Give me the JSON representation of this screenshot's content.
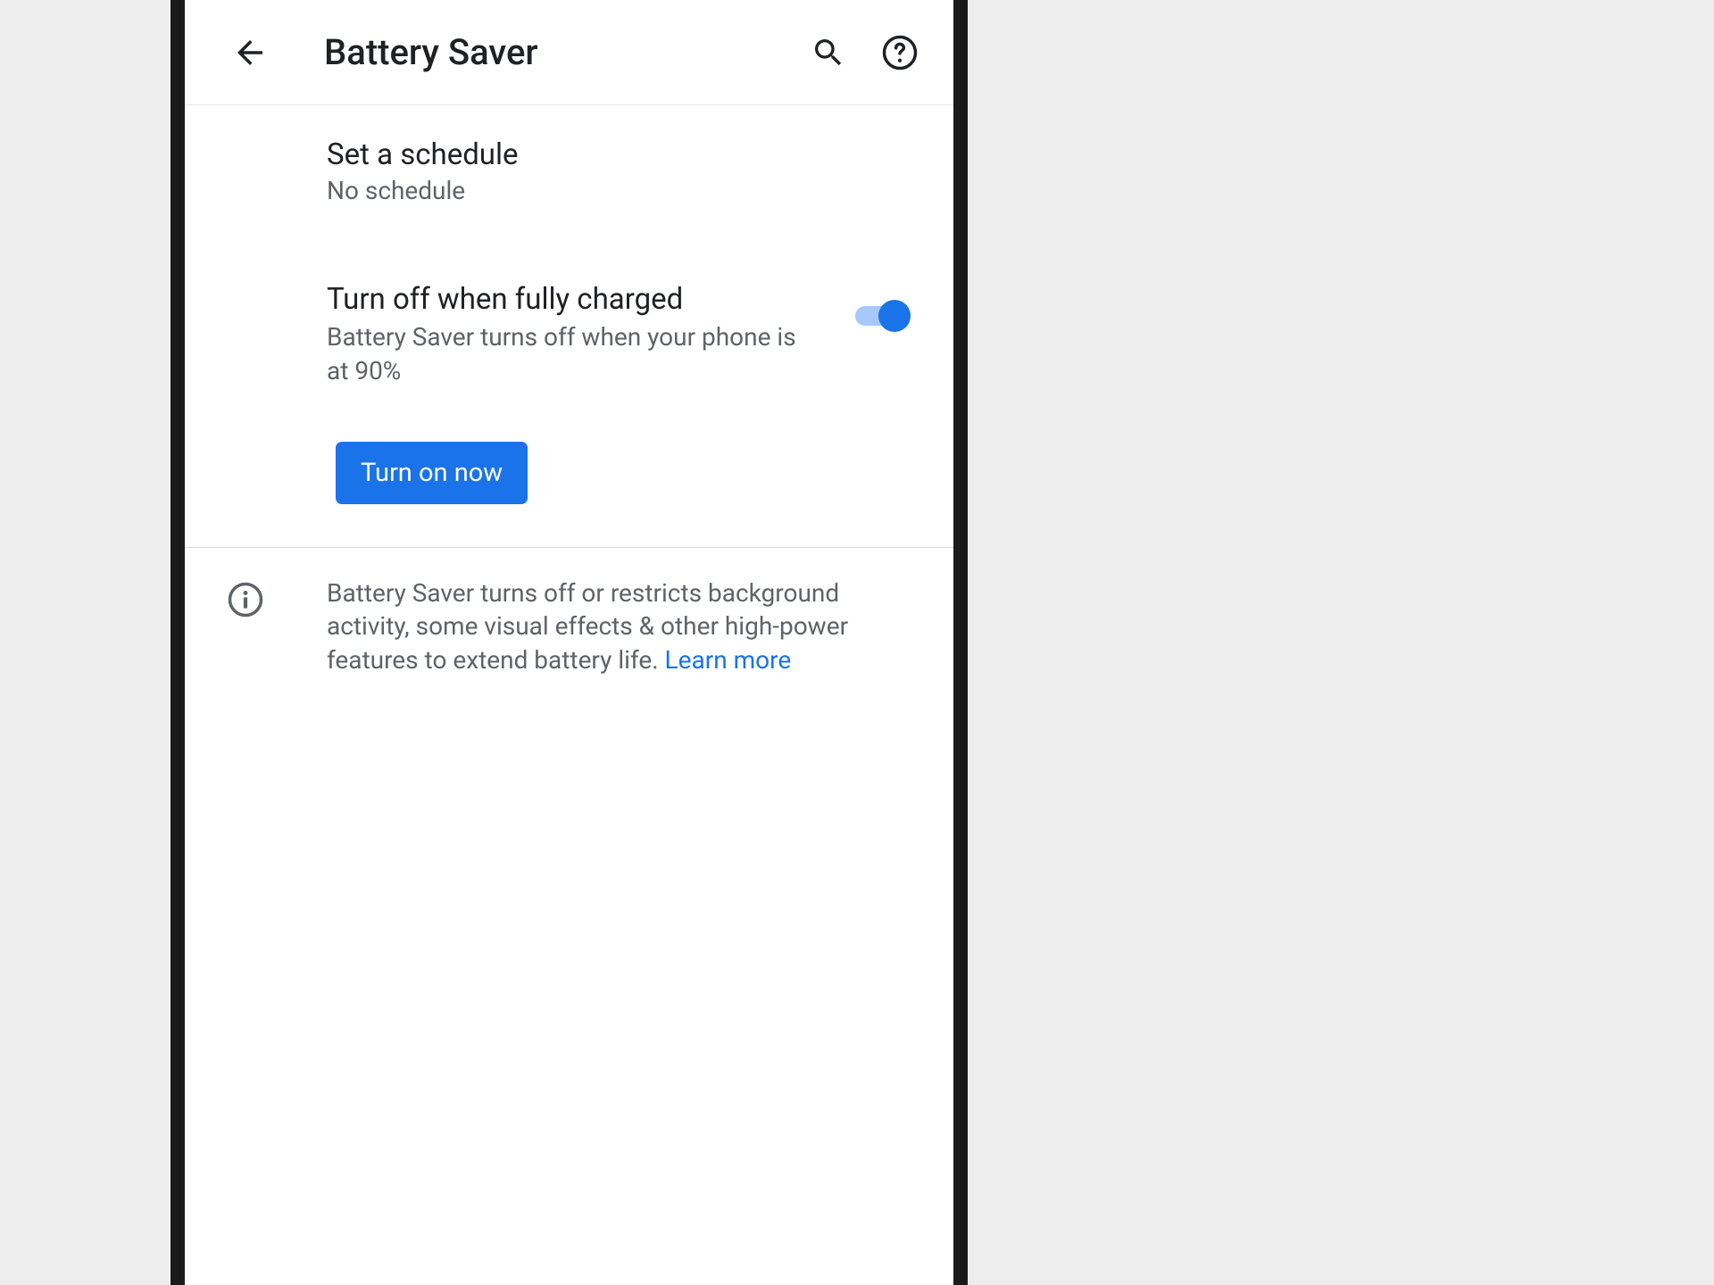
{
  "header": {
    "title": "Battery Saver"
  },
  "schedule": {
    "title": "Set a schedule",
    "subtitle": "No schedule"
  },
  "turnOffCharged": {
    "title": "Turn off when fully charged",
    "subtitle": "Battery Saver turns off when your phone is at 90%",
    "toggle": true
  },
  "button": {
    "turnOnNow": "Turn on now"
  },
  "info": {
    "text": "Battery Saver turns off or restricts background activity, some visual effects & other high-power features to extend battery life. ",
    "learnMore": "Learn more"
  }
}
